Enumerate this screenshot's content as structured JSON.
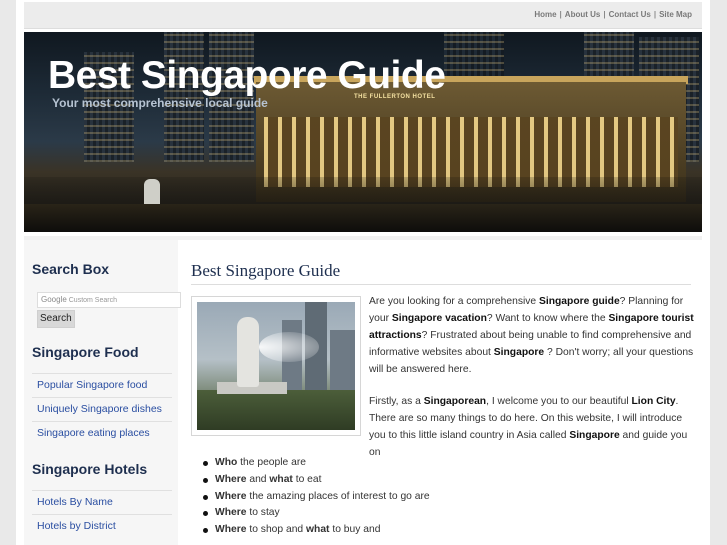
{
  "top_nav": {
    "home": "Home",
    "about": "About Us",
    "contact": "Contact Us",
    "sitemap": "Site Map",
    "separator": "|"
  },
  "header": {
    "title": "Best Singapore Guide",
    "tagline": "Your most comprehensive local guide",
    "hotel_sign": "THE FULLERTON HOTEL"
  },
  "sidebar": {
    "search_heading": "Search Box",
    "search_brand": "Google",
    "search_placeholder": "Custom Search",
    "search_button": "Search",
    "food_heading": "Singapore Food",
    "food_links": [
      "Popular Singapore food",
      "Uniquely Singapore dishes",
      "Singapore eating places"
    ],
    "hotels_heading": "Singapore Hotels",
    "hotel_links": [
      "Hotels By Name",
      "Hotels by District"
    ]
  },
  "main": {
    "title": "Best Singapore Guide",
    "para1": {
      "t1": "Are you looking for a comprehensive ",
      "b1": "Singapore guide",
      "t2": "? Planning for your ",
      "b2": "Singapore vacation",
      "t3": "? Want to know where the ",
      "b3": "Singapore tourist attractions",
      "t4": "? Frustrated about being unable to find comprehensive and informative websites about ",
      "b4": "Singapore",
      "t5": " ? Don't worry; all your questions will be answered here."
    },
    "para2": {
      "t1": "Firstly, as a ",
      "b1": "Singaporean",
      "t2": ", I welcome you to our beautiful ",
      "b2": "Lion City",
      "t3": ". There are so many things to do here. On this website, I will introduce you to this little island country in Asia called ",
      "b3": "Singapore",
      "t4": " and guide you on"
    },
    "bullets": [
      {
        "b1": "Who",
        "t1": " the people are",
        "b2": "",
        "t2": ""
      },
      {
        "b1": "Where",
        "t1": " and ",
        "b2": "what",
        "t2": " to eat"
      },
      {
        "b1": "Where",
        "t1": " the amazing places of interest to go are",
        "b2": "",
        "t2": ""
      },
      {
        "b1": "Where",
        "t1": " to stay",
        "b2": "",
        "t2": ""
      },
      {
        "b1": "Where",
        "t1": " to shop and ",
        "b2": "what",
        "t2": " to buy and"
      }
    ]
  }
}
